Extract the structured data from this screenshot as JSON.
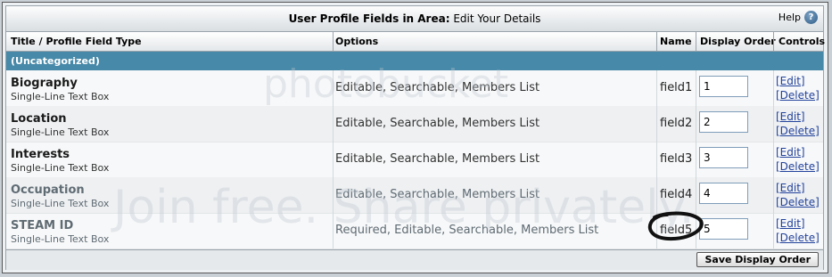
{
  "panel": {
    "title_bold": "User Profile Fields in Area:",
    "title_area": "Edit Your Details",
    "help_label": "Help",
    "help_icon": "question-mark-icon"
  },
  "columns": {
    "title": "Title / Profile Field Type",
    "options": "Options",
    "name": "Name",
    "display_order": "Display Order",
    "controls": "Controls"
  },
  "category": {
    "label": "(Uncategorized)"
  },
  "fields": [
    {
      "title": "Biography",
      "type": "Single-Line Text Box",
      "options": "Editable, Searchable, Members List",
      "name": "field1",
      "order": "1",
      "edit": "[Edit]",
      "delete": "[Delete]"
    },
    {
      "title": "Location",
      "type": "Single-Line Text Box",
      "options": "Editable, Searchable, Members List",
      "name": "field2",
      "order": "2",
      "edit": "[Edit]",
      "delete": "[Delete]"
    },
    {
      "title": "Interests",
      "type": "Single-Line Text Box",
      "options": "Editable, Searchable, Members List",
      "name": "field3",
      "order": "3",
      "edit": "[Edit]",
      "delete": "[Delete]"
    },
    {
      "title": "Occupation",
      "type": "Single-Line Text Box",
      "options": "Editable, Searchable, Members List",
      "name": "field4",
      "order": "4",
      "edit": "[Edit]",
      "delete": "[Delete]"
    },
    {
      "title": "STEAM ID",
      "type": "Single-Line Text Box",
      "options": "Required, Editable, Searchable, Members List",
      "name": "field5",
      "order": "5",
      "edit": "[Edit]",
      "delete": "[Delete]"
    }
  ],
  "footer": {
    "save_label": "Save Display Order"
  },
  "watermark": {
    "brand": "photobucket",
    "tagline": "Join free. Share privately."
  },
  "colors": {
    "category_bg": "#4789a8",
    "link": "#22429c",
    "circle_mark": "#111111"
  }
}
